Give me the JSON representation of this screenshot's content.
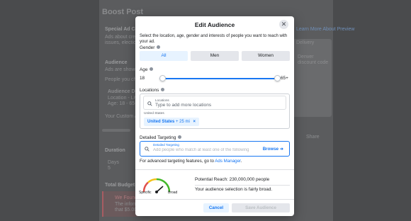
{
  "background": {
    "page_title": "Boost Post",
    "texts": [
      "Special Ad Ca",
      "Ads about cred",
      "issues, election",
      "Audience",
      "Ads are shown",
      "People you choo",
      "Audience Detai",
      "Location - Livin",
      "Age: 18 - 65+",
      "Your Custom Au",
      "Duration",
      "Days",
      "5",
      "Total Budget",
      "We Found",
      "The informat",
      "that $5.00",
      "Learn More About Preview",
      "Delivery",
      "Denver",
      "discount code",
      "Share"
    ]
  },
  "modal": {
    "title": "Edit Audience",
    "close_icon": "close-icon",
    "intro": "Select the location, age, gender and interests of people you want to reach with your ad.",
    "gender": {
      "label": "Gender",
      "options": [
        "All",
        "Men",
        "Women"
      ],
      "selected": "All"
    },
    "age": {
      "label": "Age",
      "min": "18",
      "max": "65+"
    },
    "locations": {
      "label": "Locations",
      "field_label": "Locations",
      "placeholder": "Type to add more locations",
      "country": "United States",
      "chip_country": "United States",
      "chip_radius": "+ 25 mi",
      "chip_remove": "×"
    },
    "detailed_targeting": {
      "label": "Detailed Targeting",
      "field_label": "Detailed Targeting",
      "placeholder": "Add people who match at least one of the following",
      "browse": "Browse"
    },
    "advanced": {
      "text": "For advanced targeting features, go to ",
      "link": "Ads Manager",
      "suffix": "."
    },
    "gauge": {
      "left_label": "Specific",
      "right_label": "Broad"
    },
    "reach": "Potential Reach: 230,000,000 people",
    "audience_note": "Your audience selection is fairly broad.",
    "buttons": {
      "cancel": "Cancel",
      "save": "Save Audience"
    },
    "colors": {
      "accent": "#1877f2",
      "gauge_red": "#e0504b",
      "gauge_yellow": "#f2c21a",
      "gauge_green": "#42b72a"
    }
  }
}
